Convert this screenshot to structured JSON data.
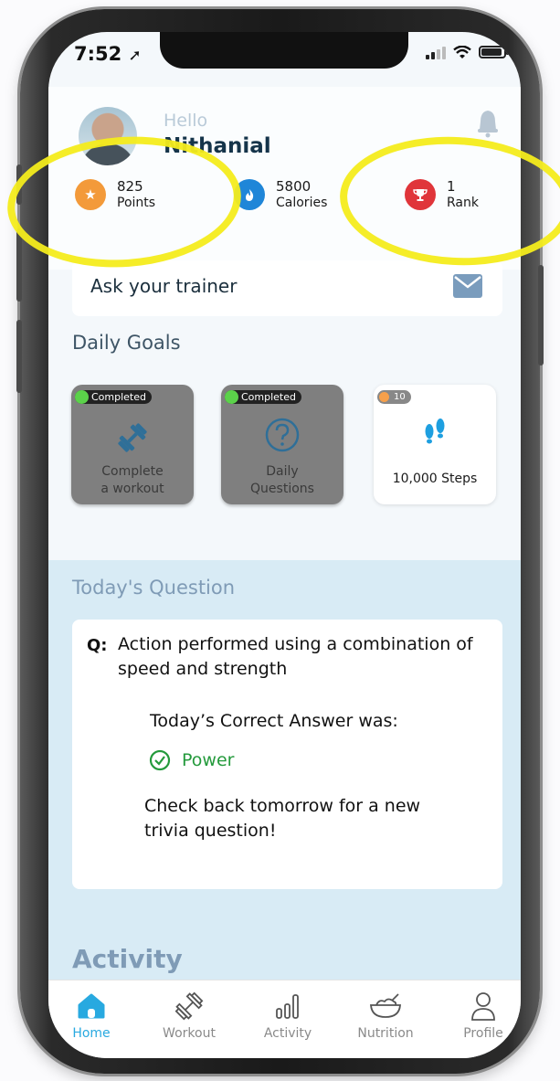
{
  "status_bar": {
    "time": "7:52",
    "location_arrow": "location-arrow-icon"
  },
  "greeting": {
    "hello": "Hello",
    "name": "Nithanial"
  },
  "stats": [
    {
      "value": "825",
      "label": "Points",
      "icon": "star-icon",
      "color": "#f39a3a"
    },
    {
      "value": "5800",
      "label": "Calories",
      "icon": "flame-icon",
      "color": "#1f86d8"
    },
    {
      "value": "1",
      "label": "Rank",
      "icon": "trophy-icon",
      "color": "#e0353a"
    }
  ],
  "trainer": {
    "label": "Ask your trainer"
  },
  "daily_goals": {
    "title": "Daily Goals",
    "items": [
      {
        "badge": "Completed",
        "label_line1": "Complete",
        "label_line2": "a workout",
        "icon": "dumbbell-icon",
        "status": "completed"
      },
      {
        "badge": "Completed",
        "label_line1": "Daily",
        "label_line2": "Questions",
        "icon": "question-icon",
        "status": "completed"
      },
      {
        "badge": "10",
        "label_line1": "10,000 Steps",
        "label_line2": "",
        "icon": "footsteps-icon",
        "status": "open"
      }
    ]
  },
  "todays_question": {
    "title": "Today's Question",
    "q_label": "Q:",
    "question": "Action performed using a combination of speed and strength",
    "answer_heading": "Today’s Correct Answer was:",
    "answer": "Power",
    "followup": "Check back tomorrow for a new trivia question!"
  },
  "activity": {
    "title": "Activity"
  },
  "tabs": [
    {
      "label": "Home",
      "icon": "home-icon",
      "active": true
    },
    {
      "label": "Workout",
      "icon": "dumbbell-icon",
      "active": false
    },
    {
      "label": "Activity",
      "icon": "bar-chart-icon",
      "active": false
    },
    {
      "label": "Nutrition",
      "icon": "bowl-icon",
      "active": false
    },
    {
      "label": "Profile",
      "icon": "person-icon",
      "active": false
    }
  ],
  "colors": {
    "accent": "#28a9e0",
    "success": "#249a3c",
    "highlight": "#f4ec1c"
  }
}
